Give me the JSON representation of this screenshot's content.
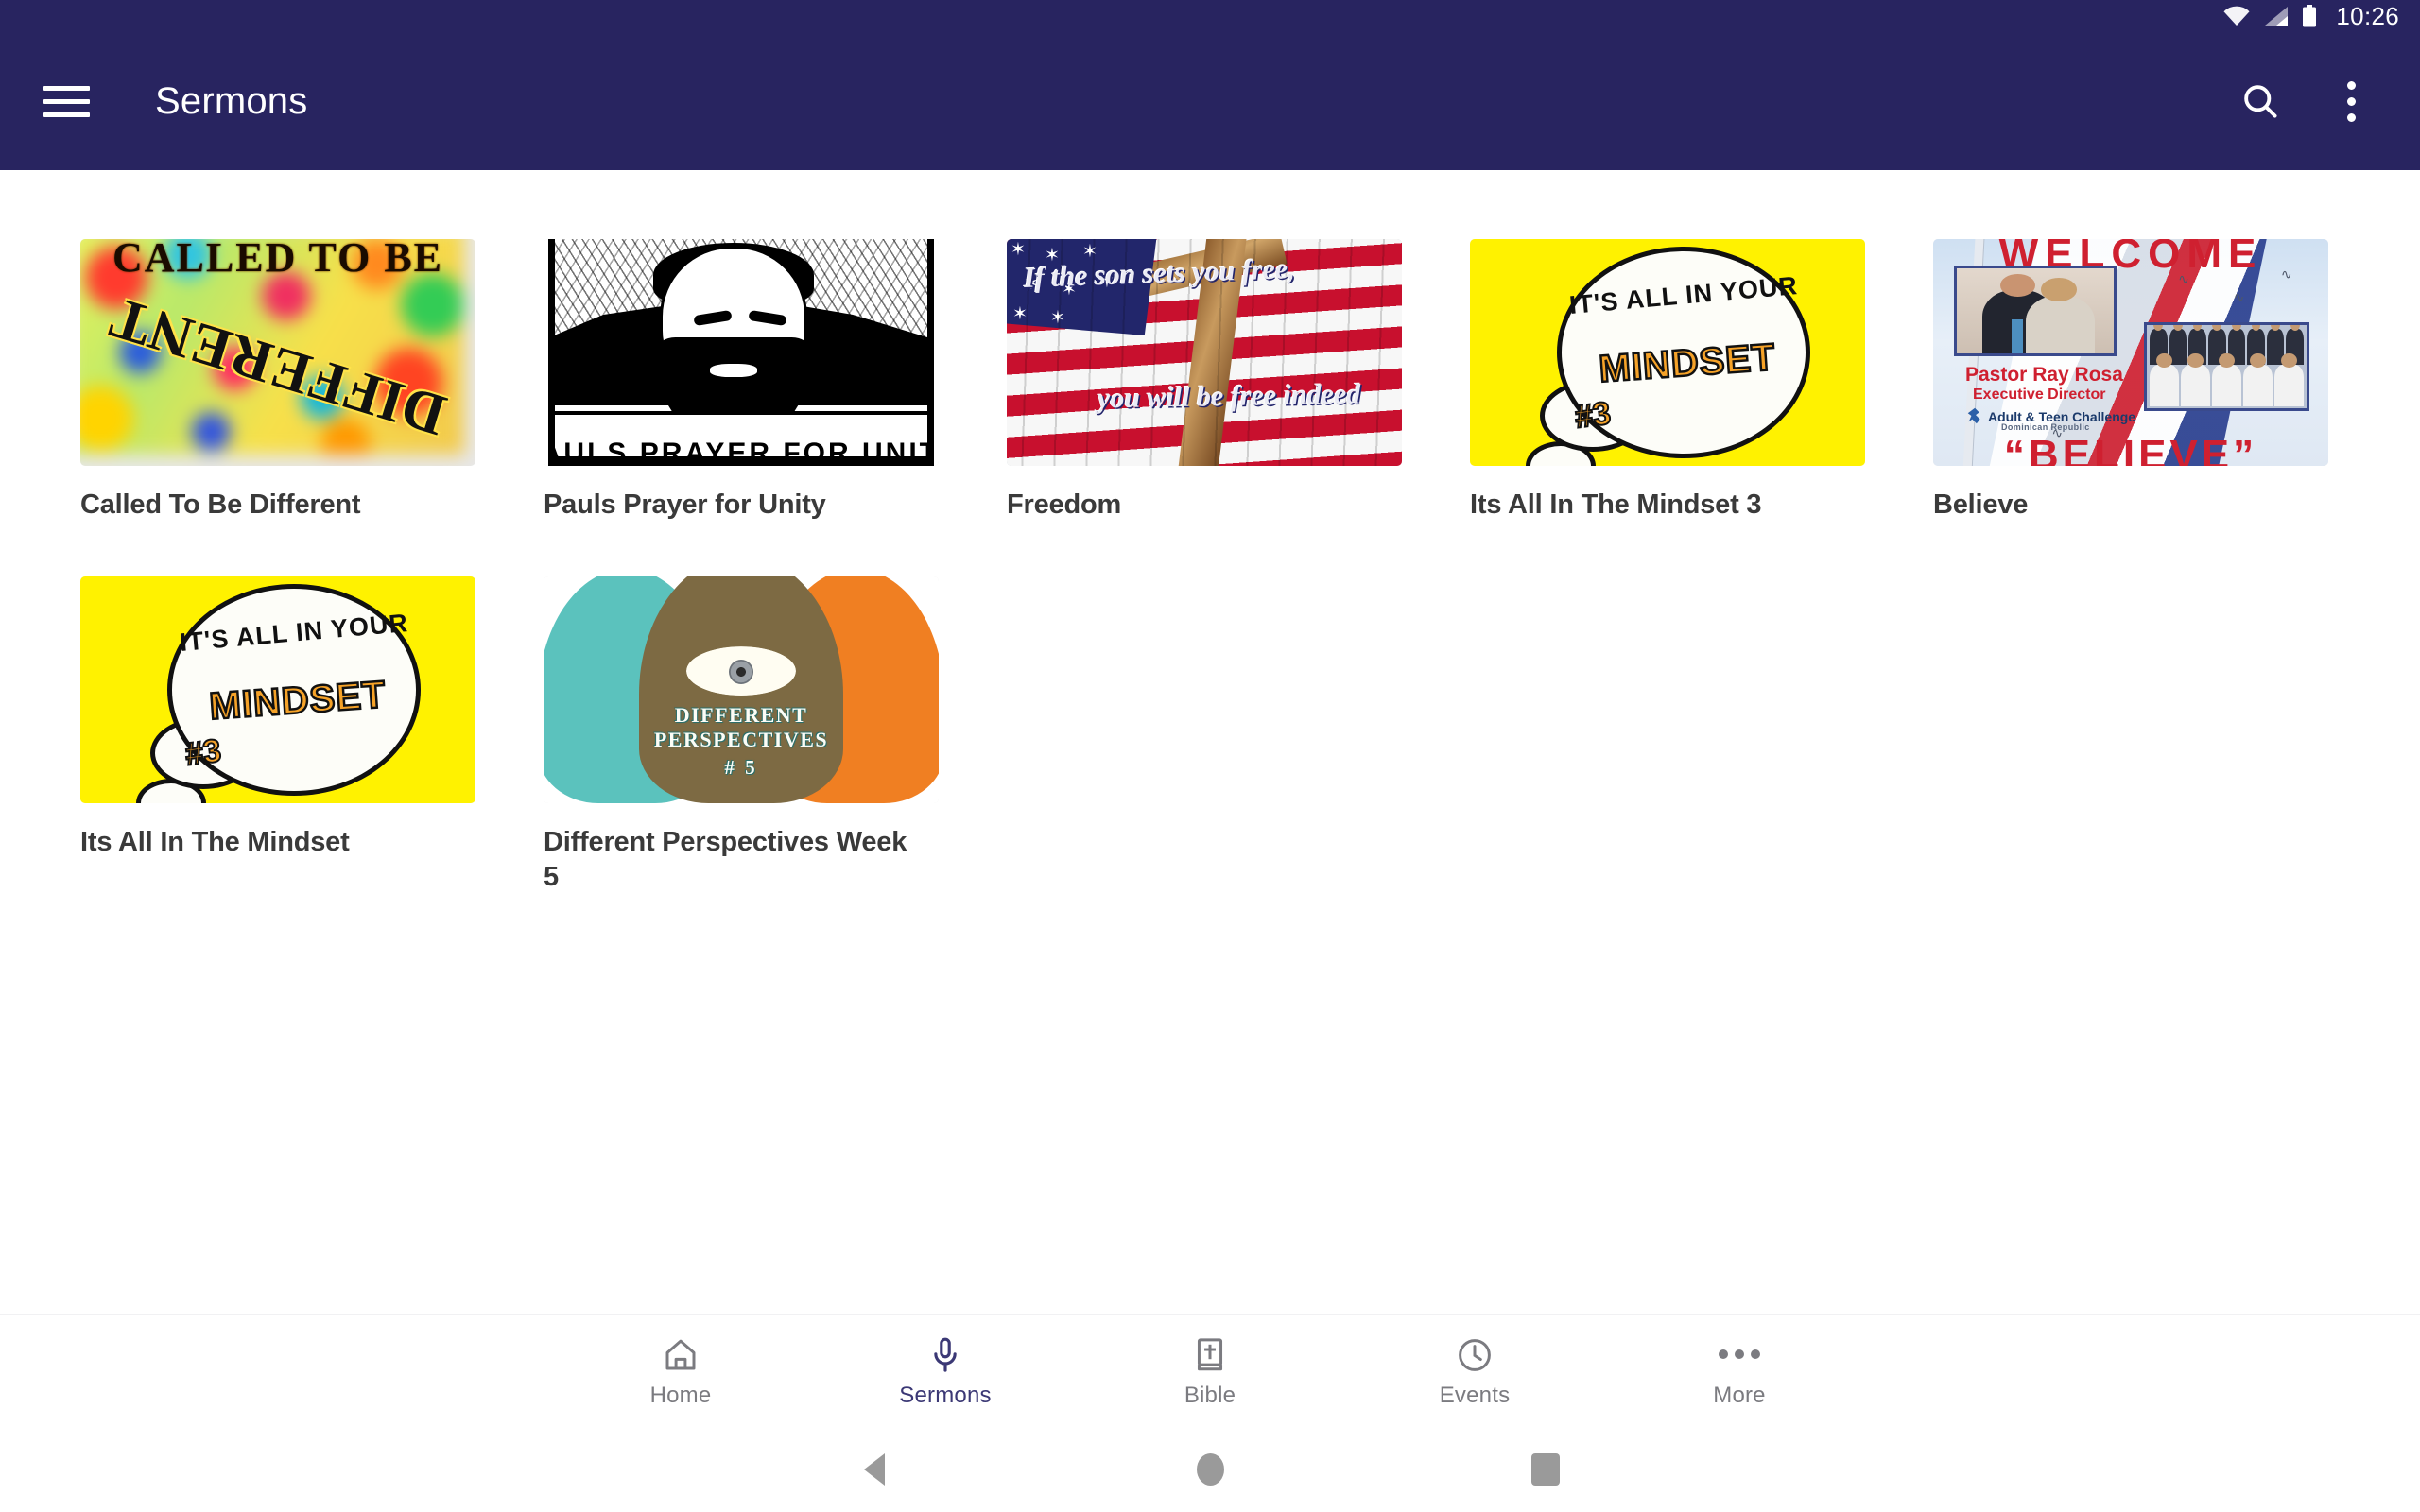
{
  "status_bar": {
    "time": "10:26",
    "icons": [
      "wifi-icon",
      "cell-signal-icon",
      "battery-icon"
    ]
  },
  "app_bar": {
    "menu_icon": "hamburger-menu-icon",
    "title": "Sermons",
    "search_icon": "search-icon",
    "overflow_icon": "overflow-menu-icon",
    "background_color": "#282460"
  },
  "sermons": [
    {
      "title": "Called To Be Different",
      "thumbnail": {
        "style": "rainbow-blur",
        "top_text": "CALLED TO BE",
        "main_text": "DIFFERENT"
      }
    },
    {
      "title": "Pauls Prayer for Unity",
      "thumbnail": {
        "style": "black-white-illustration",
        "caption": "PAULS PRAYER FOR UNITY"
      }
    },
    {
      "title": "Freedom",
      "thumbnail": {
        "style": "flag-cross",
        "line1": "If the son sets you free,",
        "line2": "you will be free indeed"
      }
    },
    {
      "title": "Its All In The Mindset 3",
      "thumbnail": {
        "style": "yellow-speech-bubble",
        "line1": "IT'S ALL IN YOUR",
        "word": "MINDSET",
        "number": "#3"
      }
    },
    {
      "title": "Believe",
      "thumbnail": {
        "style": "pastor-welcome-poster",
        "welcome": "WELCOME",
        "pastor_name": "Pastor Ray Rosa",
        "pastor_role": "Executive Director",
        "organization": "Adult & Teen Challenge",
        "country": "Dominican Republic",
        "believe": "“BELIEVE”"
      }
    },
    {
      "title": "Its All In The Mindset",
      "thumbnail": {
        "style": "yellow-speech-bubble",
        "line1": "IT'S ALL IN YOUR",
        "word": "MINDSET",
        "number": "#3"
      }
    },
    {
      "title": "Different Perspectives Week 5",
      "thumbnail": {
        "style": "three-heads-eye",
        "line1": "DIFFERENT",
        "line2": "PERSPECTIVES",
        "line3": "# 5"
      }
    }
  ],
  "bottom_nav": {
    "items": [
      {
        "label": "Home",
        "icon": "home-icon",
        "active": false
      },
      {
        "label": "Sermons",
        "icon": "microphone-icon",
        "active": true
      },
      {
        "label": "Bible",
        "icon": "bible-book-icon",
        "active": false
      },
      {
        "label": "Events",
        "icon": "clock-icon",
        "active": false
      },
      {
        "label": "More",
        "icon": "more-dots-icon",
        "active": false
      }
    ],
    "active_color": "#3b3875",
    "inactive_color": "#7b7b80"
  },
  "system_nav": {
    "back": "back-triangle-icon",
    "home": "home-circle-icon",
    "recents": "recents-square-icon"
  }
}
